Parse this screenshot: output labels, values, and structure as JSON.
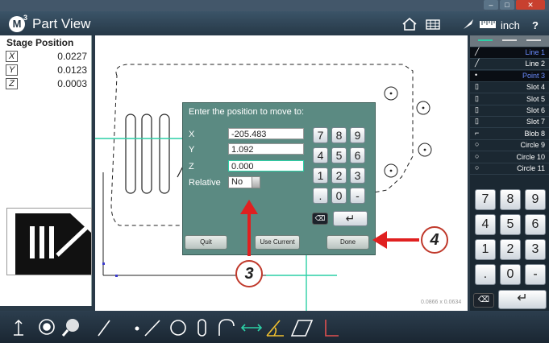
{
  "app": {
    "logo_letter": "M",
    "logo_sup": "3",
    "title": "Part View"
  },
  "toolbar": {
    "units": "inch",
    "help": "?"
  },
  "stage": {
    "title": "Stage Position",
    "axes": [
      {
        "label": "X",
        "value": "0.0227"
      },
      {
        "label": "Y",
        "value": "0.0123"
      },
      {
        "label": "Z",
        "value": "0.0003"
      }
    ]
  },
  "features": [
    {
      "icon": "line-icon",
      "label": "Line 1",
      "color": "#6b8cff"
    },
    {
      "icon": "line-icon",
      "label": "Line 2",
      "color": "#ffffff"
    },
    {
      "icon": "point-icon",
      "label": "Point 3",
      "color": "#6b8cff"
    },
    {
      "icon": "slot-icon",
      "label": "Slot 4",
      "color": "#ffffff"
    },
    {
      "icon": "slot-icon",
      "label": "Slot 5",
      "color": "#ffffff"
    },
    {
      "icon": "slot-icon",
      "label": "Slot 6",
      "color": "#ffffff"
    },
    {
      "icon": "slot-icon",
      "label": "Slot 7",
      "color": "#ffffff"
    },
    {
      "icon": "blob-icon",
      "label": "Blob 8",
      "color": "#ffffff"
    },
    {
      "icon": "circle-icon",
      "label": "Circle 9",
      "color": "#ffffff"
    },
    {
      "icon": "circle-icon",
      "label": "Circle 10",
      "color": "#ffffff"
    },
    {
      "icon": "circle-icon",
      "label": "Circle 11",
      "color": "#ffffff"
    }
  ],
  "keypad": {
    "keys": [
      "7",
      "8",
      "9",
      "4",
      "5",
      "6",
      "1",
      "2",
      "3",
      ".",
      "0",
      "-"
    ]
  },
  "dialog": {
    "title": "Enter the position to move to:",
    "x_label": "X",
    "x_value": "-205.483",
    "y_label": "Y",
    "y_value": "1.092",
    "z_label": "Z",
    "z_value": "0.000",
    "relative_label": "Relative",
    "relative_value": "No",
    "keys": [
      "7",
      "8",
      "9",
      "4",
      "5",
      "6",
      "1",
      "2",
      "3",
      ".",
      "0",
      "-"
    ],
    "quit": "Quit",
    "use_current": "Use Current",
    "done": "Done"
  },
  "callouts": {
    "three": "3",
    "four": "4"
  },
  "scale_readout": "0.0866 x 0.0634",
  "colors": {
    "accent_line": "#2ccfa6",
    "callout_red": "#e02020",
    "dialog_bg": "#5b8a82",
    "selected_feature": "#6b8cff"
  }
}
